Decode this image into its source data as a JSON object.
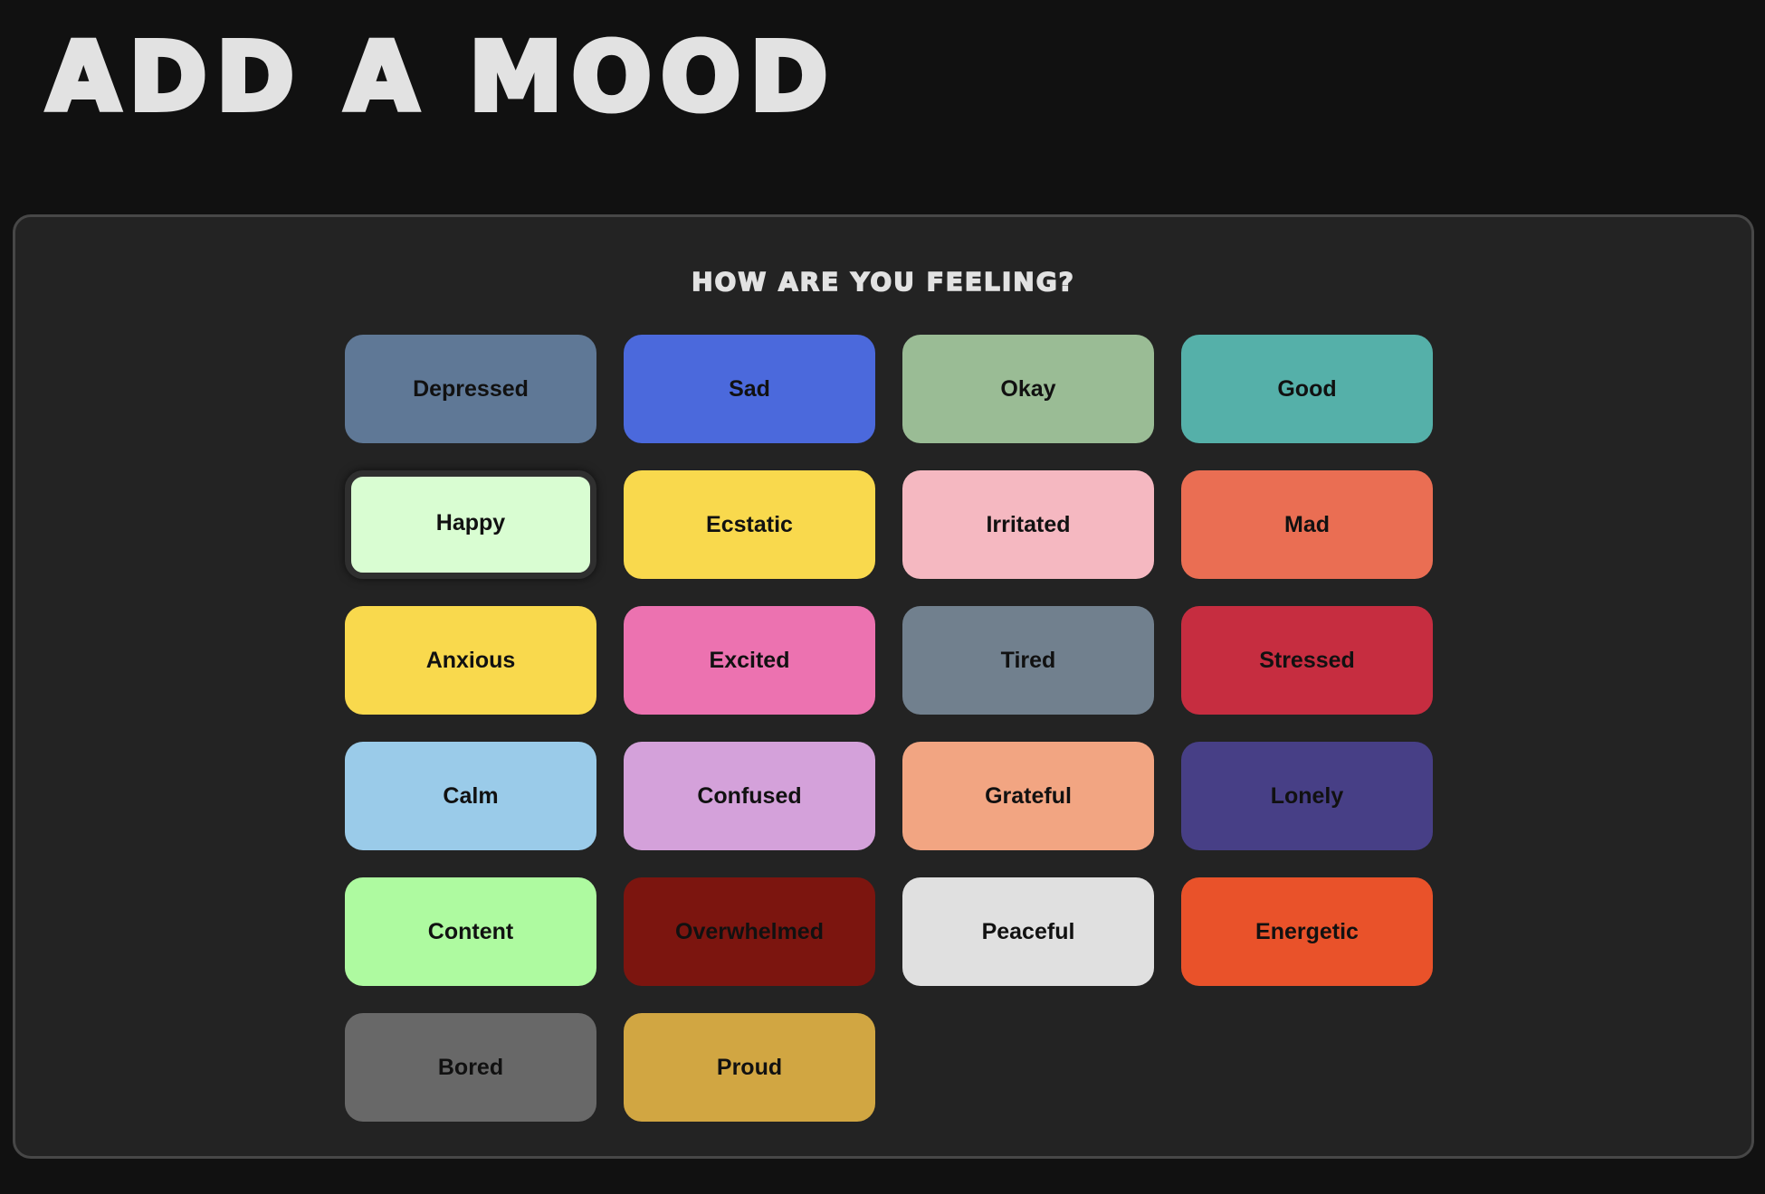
{
  "header": {
    "title": "ADD A MOOD"
  },
  "panel": {
    "heading": "HOW ARE YOU FEELING?"
  },
  "moods": [
    {
      "label": "Depressed",
      "color": "#5f7896",
      "selected": false
    },
    {
      "label": "Sad",
      "color": "#4b69dc",
      "selected": false
    },
    {
      "label": "Okay",
      "color": "#9abc95",
      "selected": false
    },
    {
      "label": "Good",
      "color": "#55b0a9",
      "selected": false
    },
    {
      "label": "Happy",
      "color": "#d9fdd2",
      "selected": true
    },
    {
      "label": "Ecstatic",
      "color": "#f9d94d",
      "selected": false
    },
    {
      "label": "Irritated",
      "color": "#f5b8c1",
      "selected": false
    },
    {
      "label": "Mad",
      "color": "#ea6e53",
      "selected": false
    },
    {
      "label": "Anxious",
      "color": "#f9d94d",
      "selected": false
    },
    {
      "label": "Excited",
      "color": "#ec72b0",
      "selected": false
    },
    {
      "label": "Tired",
      "color": "#71808e",
      "selected": false
    },
    {
      "label": "Stressed",
      "color": "#c62d40",
      "selected": false
    },
    {
      "label": "Calm",
      "color": "#9acbe9",
      "selected": false
    },
    {
      "label": "Confused",
      "color": "#d4a1da",
      "selected": false
    },
    {
      "label": "Grateful",
      "color": "#f2a582",
      "selected": false
    },
    {
      "label": "Lonely",
      "color": "#473f86",
      "selected": false
    },
    {
      "label": "Content",
      "color": "#aefaa0",
      "selected": false
    },
    {
      "label": "Overwhelmed",
      "color": "#7c150f",
      "selected": false
    },
    {
      "label": "Peaceful",
      "color": "#e0e0e0",
      "selected": false
    },
    {
      "label": "Energetic",
      "color": "#e9522a",
      "selected": false
    },
    {
      "label": "Bored",
      "color": "#686868",
      "selected": false
    },
    {
      "label": "Proud",
      "color": "#d1a642",
      "selected": false
    }
  ]
}
